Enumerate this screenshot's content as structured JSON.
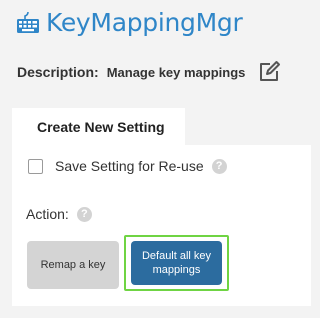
{
  "app": {
    "title": "KeyMappingMgr",
    "icon": "keyboard-icon",
    "accent": "#2f86c8"
  },
  "description": {
    "label": "Description:",
    "value": "Manage key mappings",
    "edit_icon": "edit-icon"
  },
  "tabs": [
    {
      "label": "Create New Setting",
      "active": true
    }
  ],
  "form": {
    "save_setting": {
      "label": "Save Setting for Re-use",
      "checked": false
    },
    "action_label": "Action:",
    "buttons": {
      "remap": "Remap a key",
      "default_all": "Default all key mappings"
    }
  },
  "colors": {
    "primary_button": "#2c6c9f",
    "highlight": "#6fd443",
    "secondary_button": "#d4d4d4"
  }
}
